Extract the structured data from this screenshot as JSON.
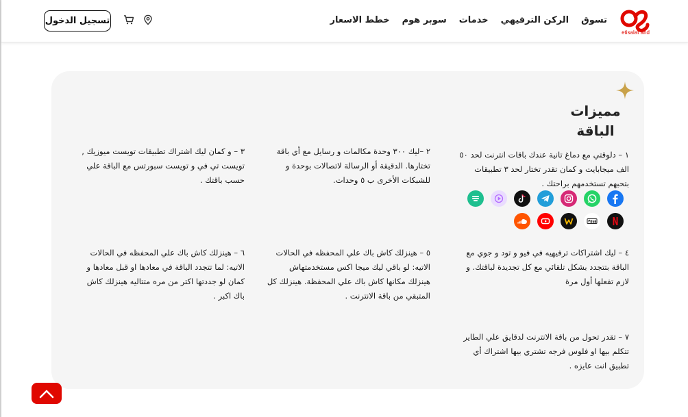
{
  "header": {
    "logo_caption": "etisalat and",
    "nav": [
      "خطط الاسعار",
      "سوبر هوم",
      "خدمات",
      "الركن الترفيهي",
      "تسوق"
    ],
    "login_label": "تسجيل الدخول",
    "icons": [
      "location-pin-icon",
      "shopping-cart-icon"
    ]
  },
  "section": {
    "title_line1": "مميزات",
    "title_line2": "الباقة"
  },
  "features": [
    "١ – دلوقتي مع دماغ تانية عندك باقات انترنت لحد ٥٠ الف ميجابايت و كمان تقدر تختار لحد ٣ تطبيقات بتحبهم تستخدمهم براحتك .",
    "٢ –ليك ٣٠٠ وحدة مكالمات و رسايل مع أي باقة تختارها. الدقيقة أو الرسالة لاتصالات بوحدة و للشبكات الأخرى ب ٥ وحدات.",
    "٣ – و كمان ليك اشتراك تطبيقات تويست ميوزيك , تويست تي في و تويست سبورتس مع الباقة علي حسب باقتك .",
    "٤ – ليك اشتراكات ترفيهيه في فيو و تود و جوي مع الباقة بتتجدد بشكل تلقائي مع كل تجديدة لباقتك. و لازم تفعلها أول مرة",
    "٥ – هينزلك كاش باك علي المحفظه في الحالات الاتيه: لو باقي ليك ميجا اكس مستخدمتهاش هينزلك مكانها كاش باك علي المحفظة. هينزلك كل المتبقي من باقة الانترنت .",
    "٦ – هينزلك كاش باك علي المحفظه في الحالات الاتيه: لما تتجدد الباقة في معادها او قبل معادها و كمان لو جددتها اكتر من مره متتاليه هينزلك كاش باك اكبر .",
    "٧ – تقدر تحول من باقة الانترنت لدقايق علي الطاير تتكلم بيها او فلوس فرجه تشتري بيها اشتراك أي تطبيق انت عايزه ."
  ],
  "apps": [
    {
      "name": "facebook-icon",
      "color": "#1877f2"
    },
    {
      "name": "whatsapp-icon",
      "color": "#25d366"
    },
    {
      "name": "instagram-icon",
      "color": "#d62976"
    },
    {
      "name": "telegram-icon",
      "color": "#229ed9"
    },
    {
      "name": "tiktok-icon",
      "color": "#111111"
    },
    {
      "name": "music-play-icon",
      "color": "#eadcff"
    },
    {
      "name": "chat-app-icon",
      "color": "#1fbf8f"
    },
    {
      "name": "netflix-icon",
      "color": "#111111"
    },
    {
      "name": "pubg-icon",
      "color": "#ffffff"
    },
    {
      "name": "watch-it-icon",
      "color": "#111111"
    },
    {
      "name": "youtube-icon",
      "color": "#ff0000"
    },
    {
      "name": "soundcloud-icon",
      "color": "#ff5500"
    }
  ],
  "colors": {
    "brand": "#e00800",
    "card_bg": "#f5f5f5",
    "sparkle": "#c9a24a"
  }
}
